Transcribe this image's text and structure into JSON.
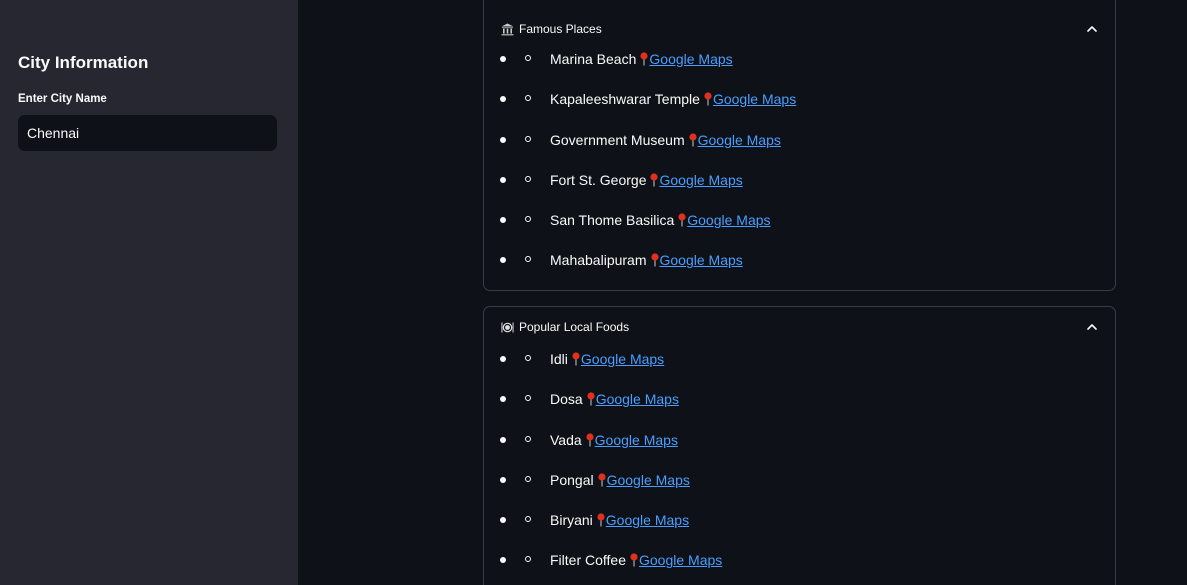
{
  "sidebar": {
    "title": "City Information",
    "input_label": "Enter City Name",
    "input_value": "Chennai"
  },
  "places": {
    "title": "Famous Places",
    "icon": "classical-building-icon",
    "items": [
      {
        "name": "Marina Beach",
        "link": "Google Maps"
      },
      {
        "name": "Kapaleeshwarar Temple",
        "link": "Google Maps"
      },
      {
        "name": "Government Museum",
        "link": "Google Maps"
      },
      {
        "name": "Fort St. George",
        "link": "Google Maps"
      },
      {
        "name": "San Thome Basilica",
        "link": "Google Maps"
      },
      {
        "name": "Mahabalipuram",
        "link": "Google Maps"
      }
    ]
  },
  "foods": {
    "title": "Popular Local Foods",
    "icon": "plate-cutlery-icon",
    "items": [
      {
        "name": "Idli",
        "link": "Google Maps"
      },
      {
        "name": "Dosa",
        "link": "Google Maps"
      },
      {
        "name": "Vada",
        "link": "Google Maps"
      },
      {
        "name": "Pongal",
        "link": "Google Maps"
      },
      {
        "name": "Biryani",
        "link": "Google Maps"
      },
      {
        "name": "Filter Coffee",
        "link": "Google Maps"
      }
    ]
  },
  "colors": {
    "background": "#0e1117",
    "sidebar": "#262730",
    "link": "#4a9eff",
    "pin": "#e0301e",
    "border": "#3a3d48"
  }
}
